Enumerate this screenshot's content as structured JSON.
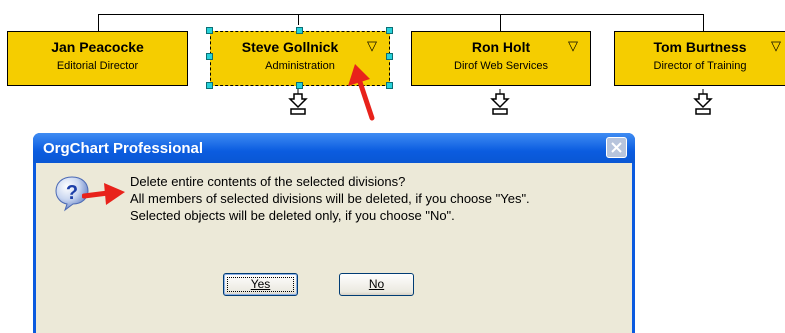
{
  "org_chart": {
    "nodes": [
      {
        "name": "Jan Peacocke",
        "title": "Editorial Director",
        "has_menu": false
      },
      {
        "name": "Steve Gollnick",
        "title": "Administration",
        "has_menu": true,
        "selected": true
      },
      {
        "name": "Ron Holt",
        "title": "Dirof Web Services",
        "has_menu": true
      },
      {
        "name": "Tom Burtness",
        "title": "Director of Training",
        "has_menu": true
      }
    ],
    "menu_glyph": "▽",
    "node_color": "#f5cd00",
    "handle_color": "#27d1d9"
  },
  "dialog": {
    "title": "OrgChart Professional",
    "close_glyph": "✕",
    "icon": "question-icon",
    "lines": [
      "Delete entire contents of the selected divisions?",
      "All members of selected divisions will be deleted, if you choose \"Yes\".",
      "Selected objects will be deleted only, if you choose \"No\"."
    ],
    "buttons": {
      "yes": "Yes",
      "no": "No"
    },
    "title_color": "#0a5adf",
    "body_color": "#ece9d8"
  },
  "annotations": {
    "arrow_color": "#e8221b"
  }
}
